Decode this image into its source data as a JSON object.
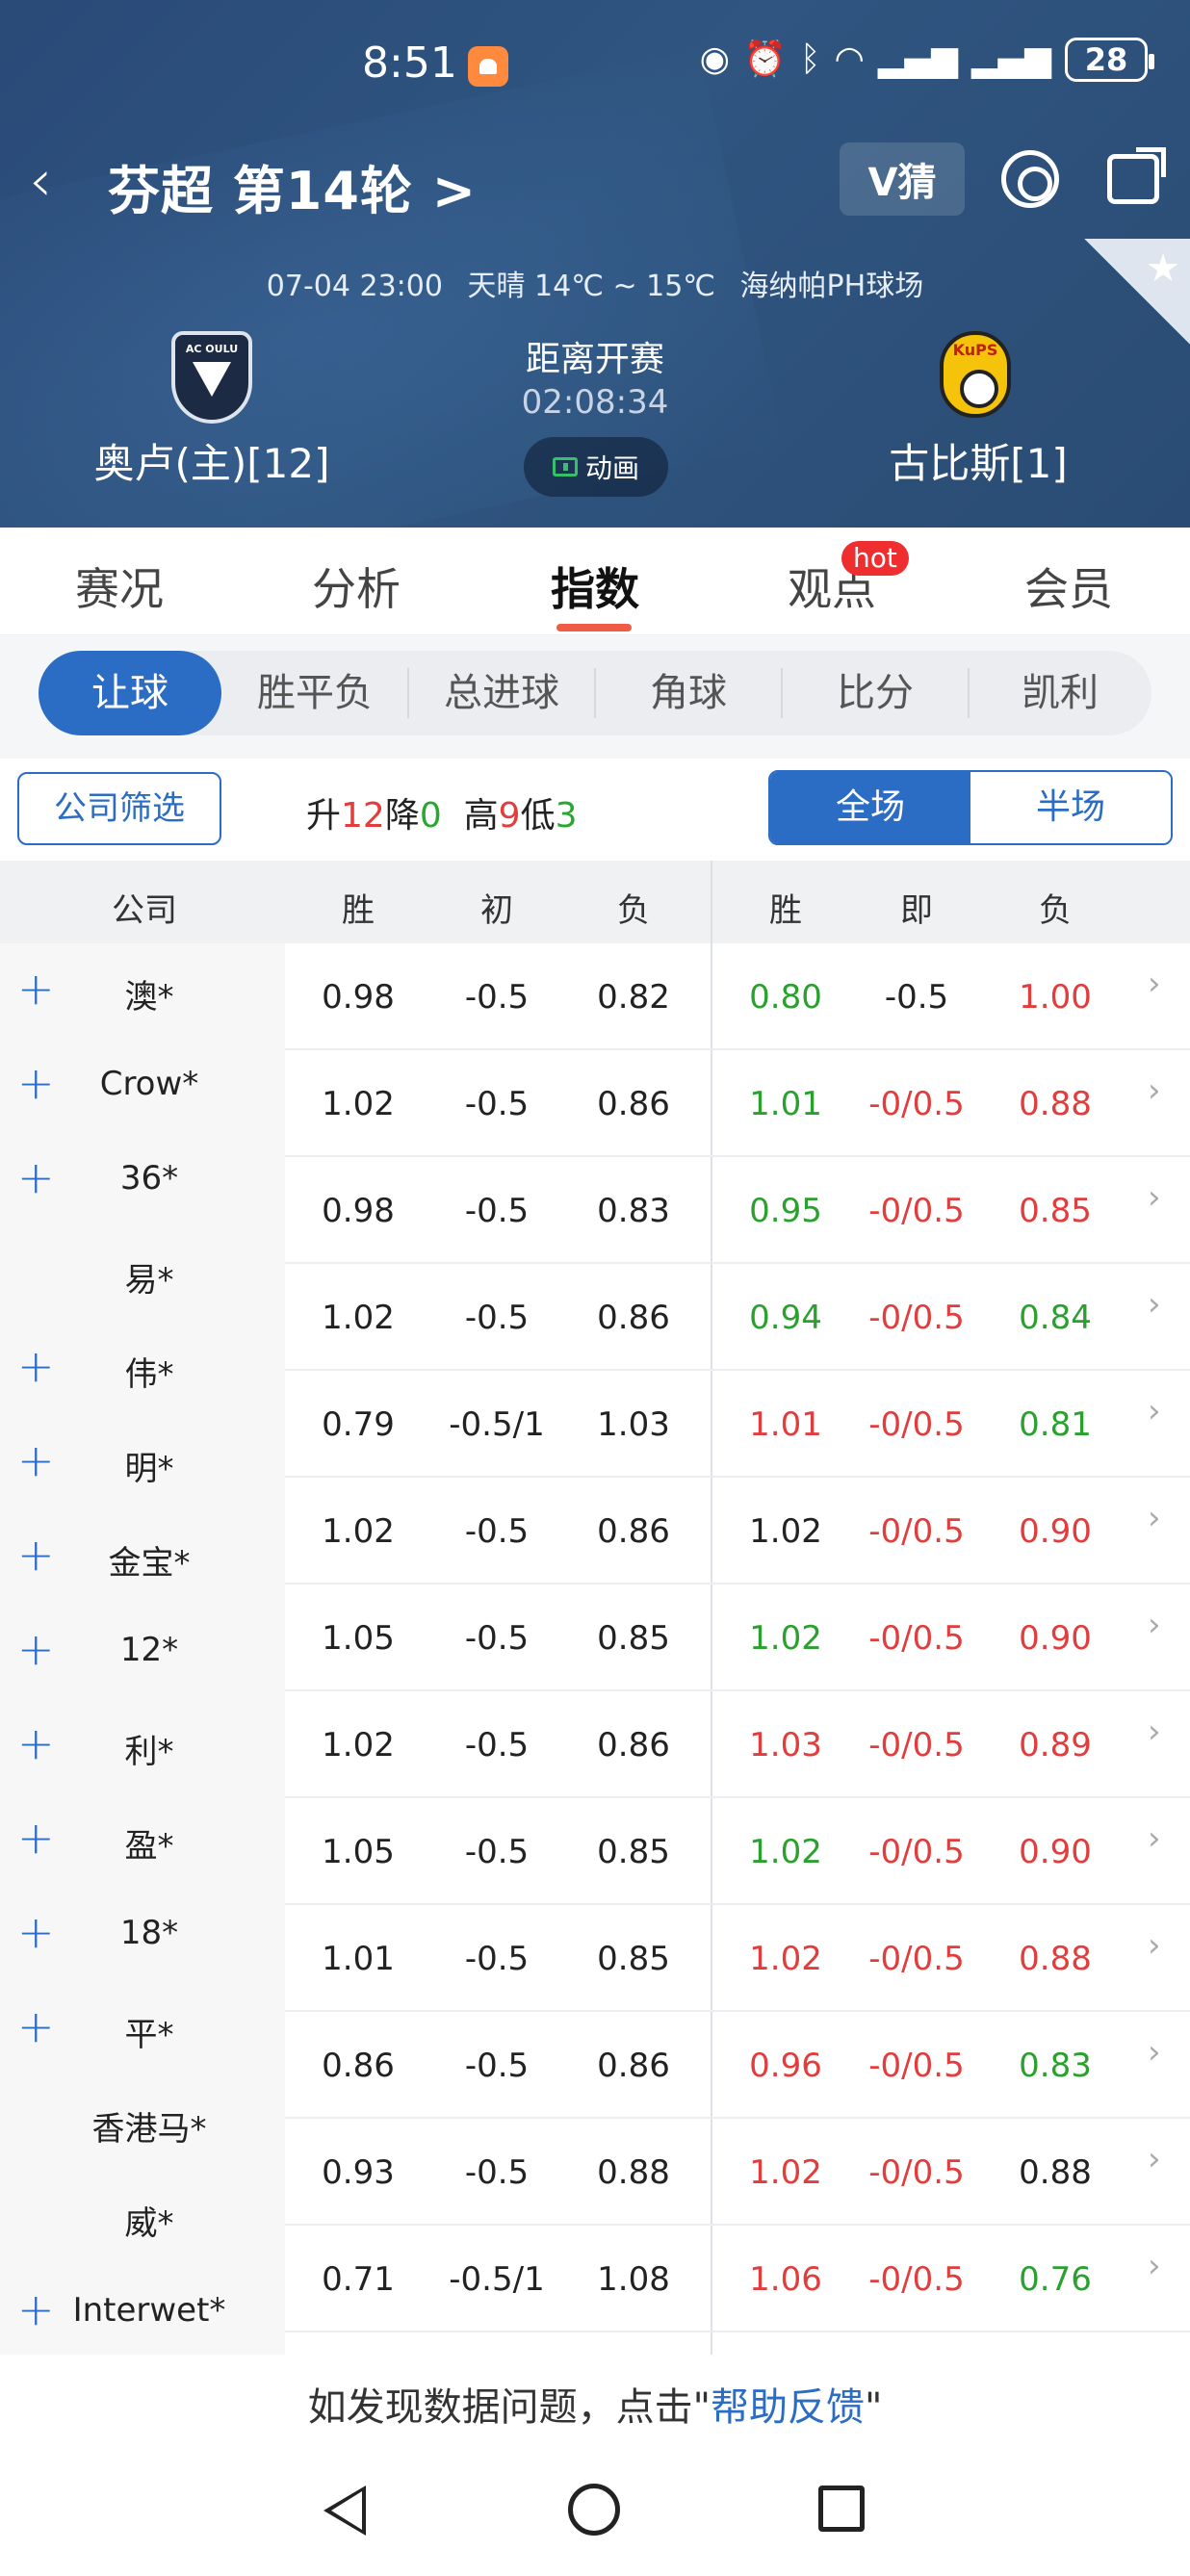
{
  "status_bar": {
    "time": "8:51",
    "battery": "28",
    "icons": [
      "eye-icon",
      "alarm-icon",
      "bluetooth-icon",
      "wifi-icon",
      "5g-signal-icon",
      "4g-signal-icon"
    ]
  },
  "header": {
    "title": "芬超 第14轮 >",
    "vguess": "V猜",
    "match_time": "07-04 23:00",
    "weather": "天晴 14℃ ~ 15℃",
    "venue": "海纳帕PH球场",
    "home_team": "奥卢(主)[12]",
    "home_logo_text": "AC OULU",
    "away_team": "古比斯[1]",
    "away_logo_text": "KuPS",
    "countdown_label": "距离开赛",
    "countdown": "02:08:34",
    "animation": "动画"
  },
  "tabs": [
    {
      "label": "赛况",
      "active": false
    },
    {
      "label": "分析",
      "active": false
    },
    {
      "label": "指数",
      "active": true
    },
    {
      "label": "观点",
      "active": false,
      "badge": "hot"
    },
    {
      "label": "会员",
      "active": false
    }
  ],
  "subtabs": [
    {
      "label": "让球",
      "active": true
    },
    {
      "label": "胜平负",
      "active": false
    },
    {
      "label": "总进球",
      "active": false
    },
    {
      "label": "角球",
      "active": false
    },
    {
      "label": "比分",
      "active": false
    },
    {
      "label": "凯利",
      "active": false
    }
  ],
  "filters": {
    "company_filter": "公司筛选",
    "up_label": "升",
    "up": "12",
    "down_label": "降",
    "down": "0",
    "high_label": "高",
    "high": "9",
    "low_label": "低",
    "low": "3",
    "full": "全场",
    "half": "半场"
  },
  "table": {
    "headers": [
      "公司",
      "胜",
      "初",
      "负",
      "胜",
      "即",
      "负"
    ],
    "rows": [
      {
        "plus": true,
        "company": "澳*",
        "init_win": "0.98",
        "init_line": "-0.5",
        "init_lose": "0.82",
        "live_win": "0.80",
        "live_win_color": "green",
        "live_line": "-0.5",
        "live_line_color": "dark",
        "live_lose": "1.00",
        "live_lose_color": "red"
      },
      {
        "plus": true,
        "company": "Crow*",
        "init_win": "1.02",
        "init_line": "-0.5",
        "init_lose": "0.86",
        "live_win": "1.01",
        "live_win_color": "green",
        "live_line": "-0/0.5",
        "live_line_color": "red",
        "live_lose": "0.88",
        "live_lose_color": "red"
      },
      {
        "plus": true,
        "company": "36*",
        "init_win": "0.98",
        "init_line": "-0.5",
        "init_lose": "0.83",
        "live_win": "0.95",
        "live_win_color": "green",
        "live_line": "-0/0.5",
        "live_line_color": "red",
        "live_lose": "0.85",
        "live_lose_color": "red"
      },
      {
        "plus": false,
        "company": "易*",
        "init_win": "1.02",
        "init_line": "-0.5",
        "init_lose": "0.86",
        "live_win": "0.94",
        "live_win_color": "green",
        "live_line": "-0/0.5",
        "live_line_color": "red",
        "live_lose": "0.84",
        "live_lose_color": "green"
      },
      {
        "plus": true,
        "company": "伟*",
        "init_win": "0.79",
        "init_line": "-0.5/1",
        "init_lose": "1.03",
        "live_win": "1.01",
        "live_win_color": "red",
        "live_line": "-0/0.5",
        "live_line_color": "red",
        "live_lose": "0.81",
        "live_lose_color": "green"
      },
      {
        "plus": true,
        "company": "明*",
        "init_win": "1.02",
        "init_line": "-0.5",
        "init_lose": "0.86",
        "live_win": "1.02",
        "live_win_color": "dark",
        "live_line": "-0/0.5",
        "live_line_color": "red",
        "live_lose": "0.90",
        "live_lose_color": "red"
      },
      {
        "plus": true,
        "company": "金宝*",
        "init_win": "1.05",
        "init_line": "-0.5",
        "init_lose": "0.85",
        "live_win": "1.02",
        "live_win_color": "green",
        "live_line": "-0/0.5",
        "live_line_color": "red",
        "live_lose": "0.90",
        "live_lose_color": "red"
      },
      {
        "plus": true,
        "company": "12*",
        "init_win": "1.02",
        "init_line": "-0.5",
        "init_lose": "0.86",
        "live_win": "1.03",
        "live_win_color": "red",
        "live_line": "-0/0.5",
        "live_line_color": "red",
        "live_lose": "0.89",
        "live_lose_color": "red"
      },
      {
        "plus": true,
        "company": "利*",
        "init_win": "1.05",
        "init_line": "-0.5",
        "init_lose": "0.85",
        "live_win": "1.02",
        "live_win_color": "green",
        "live_line": "-0/0.5",
        "live_line_color": "red",
        "live_lose": "0.90",
        "live_lose_color": "red"
      },
      {
        "plus": true,
        "company": "盈*",
        "init_win": "1.01",
        "init_line": "-0.5",
        "init_lose": "0.85",
        "live_win": "1.02",
        "live_win_color": "red",
        "live_line": "-0/0.5",
        "live_line_color": "red",
        "live_lose": "0.88",
        "live_lose_color": "red"
      },
      {
        "plus": true,
        "company": "18*",
        "init_win": "0.86",
        "init_line": "-0.5",
        "init_lose": "0.86",
        "live_win": "0.96",
        "live_win_color": "red",
        "live_line": "-0/0.5",
        "live_line_color": "red",
        "live_lose": "0.83",
        "live_lose_color": "green"
      },
      {
        "plus": true,
        "company": "平*",
        "init_win": "0.93",
        "init_line": "-0.5",
        "init_lose": "0.88",
        "live_win": "1.02",
        "live_win_color": "red",
        "live_line": "-0/0.5",
        "live_line_color": "red",
        "live_lose": "0.88",
        "live_lose_color": "dark"
      },
      {
        "plus": false,
        "company": "香港马*",
        "init_win": "0.71",
        "init_line": "-0.5/1",
        "init_lose": "1.08",
        "live_win": "1.06",
        "live_win_color": "red",
        "live_line": "-0/0.5",
        "live_line_color": "red",
        "live_lose": "0.76",
        "live_lose_color": "green"
      },
      {
        "plus": false,
        "company": "威*",
        "init_win": "",
        "init_line": "",
        "init_lose": "",
        "live_win": "",
        "live_win_color": "dark",
        "live_line": "",
        "live_line_color": "dark",
        "live_lose": "",
        "live_lose_color": "dark"
      },
      {
        "plus": true,
        "company": "Interwet*",
        "init_win": "",
        "init_line": "",
        "init_lose": "",
        "live_win": "",
        "live_win_color": "dark",
        "live_line": "",
        "live_line_color": "dark",
        "live_lose": "",
        "live_lose_color": "dark"
      }
    ]
  },
  "footer": {
    "feedback_prefix": "如发现数据问题，点击\"",
    "feedback_link": "帮助反馈",
    "feedback_suffix": "\""
  },
  "colors": {
    "accent": "#2b6cc4",
    "header_bg": "#2f5580",
    "red": "#e23c3c",
    "green": "#2aa12e",
    "tab_underline": "#ef5b43"
  }
}
